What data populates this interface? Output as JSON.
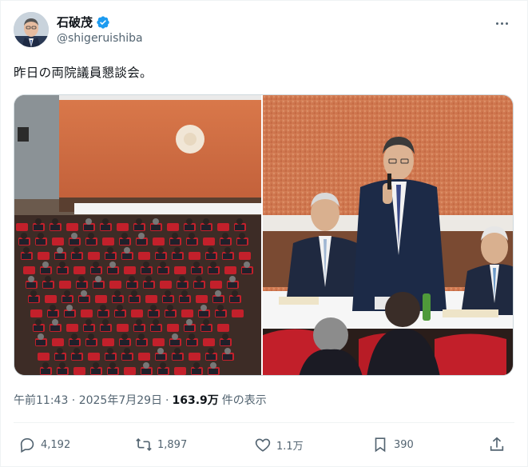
{
  "author": {
    "name": "石破茂",
    "handle": "@shigeruishiba",
    "verified": true,
    "verified_color": "#1d9bf0"
  },
  "tweet": {
    "text": "昨日の両院議員懇談会。"
  },
  "media": {
    "photos": [
      {
        "scene": "meeting-hall-wide-shot"
      },
      {
        "scene": "speaker-at-microphone"
      }
    ]
  },
  "meta": {
    "timestamp": "午前11:43 · 2025年7月29日",
    "separator": "·",
    "views_count": "163.9万",
    "views_label": "件の表示"
  },
  "actions": {
    "reply_count": "4,192",
    "repost_count": "1,897",
    "like_count": "1.1万",
    "bookmark_count": "390"
  },
  "colors": {
    "text_primary": "#0f1419",
    "text_secondary": "#536471",
    "border": "#eff3f4"
  }
}
